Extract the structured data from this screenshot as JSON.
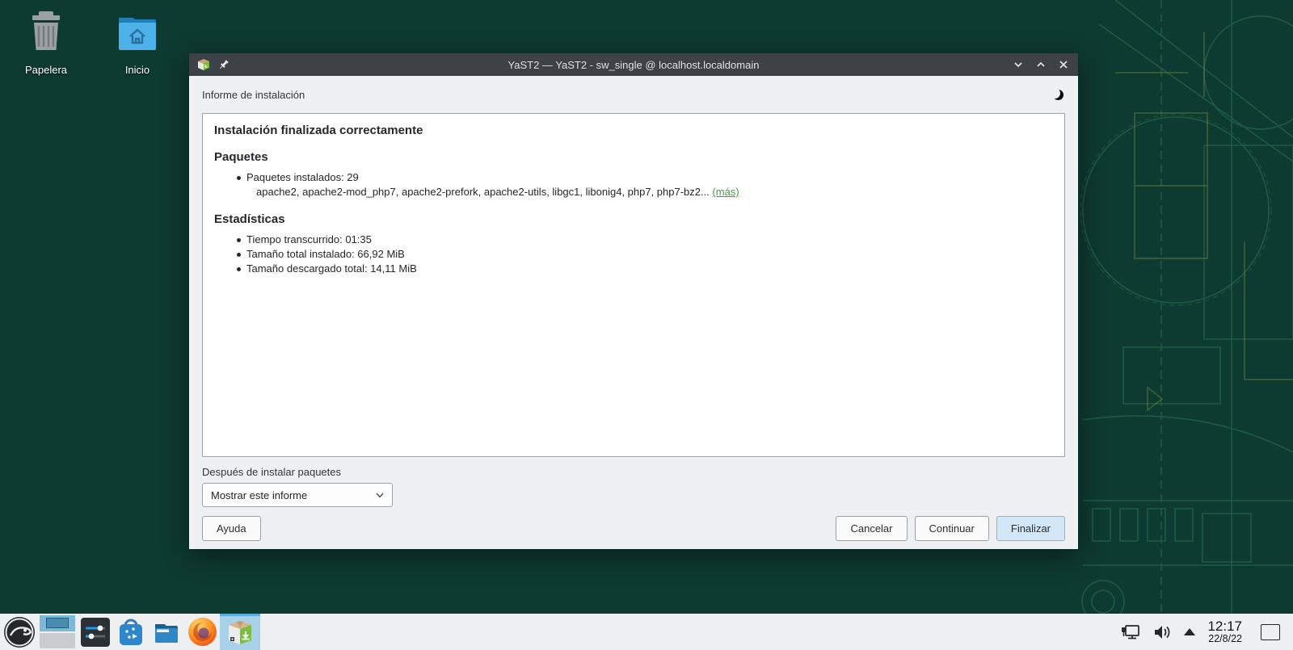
{
  "desktop": {
    "trash_label": "Papelera",
    "home_label": "Inicio"
  },
  "window": {
    "title": "YaST2 — YaST2 - sw_single @ localhost.localdomain",
    "header": "Informe de instalación",
    "report": {
      "title": "Instalación finalizada correctamente",
      "packages_heading": "Paquetes",
      "packages_installed": "Paquetes instalados: 29",
      "packages_list": "apache2, apache2-mod_php7, apache2-prefork, apache2-utils, libgc1, libonig4, php7, php7-bz2... ",
      "more_link": "(más)",
      "stats_heading": "Estadísticas",
      "stats": [
        "Tiempo transcurrido: 01:35",
        "Tamaño total instalado: 66,92 MiB",
        "Tamaño descargado total: 14,11 MiB"
      ]
    },
    "after_install_label": "Después de instalar paquetes",
    "dropdown_value": "Mostrar este informe",
    "buttons": {
      "help": "Ayuda",
      "cancel": "Cancelar",
      "continue": "Continuar",
      "finish": "Finalizar"
    }
  },
  "taskbar": {
    "clock_time": "12:17",
    "clock_date": "22/8/22"
  },
  "colors": {
    "titlebar": "#3c4247",
    "window_bg": "#eff0f1",
    "accent": "#3daee9",
    "link_green": "#3f9e3f",
    "desktop_bg": "#0d3a31",
    "finish_button_bg": "#d2e7f7"
  }
}
